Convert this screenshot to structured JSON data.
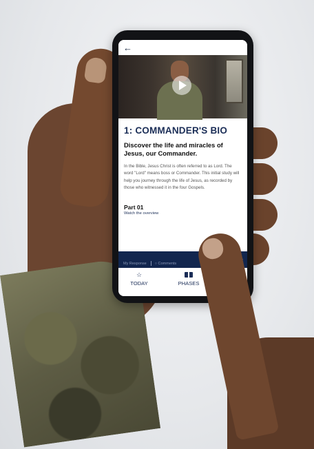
{
  "app": {
    "back_icon": "arrow-left-icon",
    "brand_color": "#1b2e57"
  },
  "video": {
    "play_icon": "play-icon"
  },
  "lesson": {
    "title": "1: COMMANDER'S BIO",
    "subtitle": "Discover the life and miracles of Jesus, our Commander.",
    "body": "In the Bible, Jesus Christ is often referred to as Lord. The word \"Lord\" means boss or Commander. This initial study will help you journey through the life of Jesus, as recorded by those who witnessed it in the four Gospels.",
    "part_title": "Part 01",
    "part_subtitle": "Watch the overview"
  },
  "action_bar": {
    "my_response": "My Response",
    "comments": "Comments",
    "next_icon": "double-chevron-right-icon"
  },
  "tabs": [
    {
      "label": "TODAY",
      "icon": "star-icon"
    },
    {
      "label": "PHASES",
      "icon": "book-icon"
    }
  ]
}
